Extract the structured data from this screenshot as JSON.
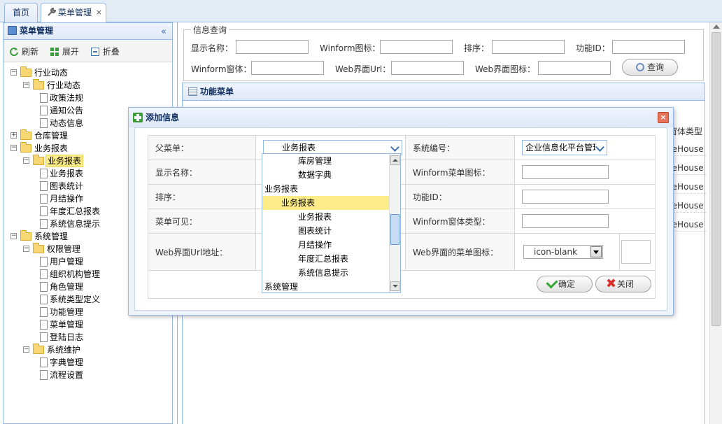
{
  "tabs": [
    {
      "label": "首页"
    },
    {
      "label": "菜单管理",
      "close": "×"
    }
  ],
  "left_panel": {
    "title": "菜单管理",
    "collapse": "«",
    "tools": {
      "refresh": "刷新",
      "expand": "展开",
      "collapse": "折叠"
    },
    "tree": [
      {
        "label": "行业动态",
        "level": 0,
        "type": "folder",
        "toggle": "−"
      },
      {
        "label": "行业动态",
        "level": 1,
        "type": "folder",
        "toggle": "−"
      },
      {
        "label": "政策法规",
        "level": 2,
        "type": "file"
      },
      {
        "label": "通知公告",
        "level": 2,
        "type": "file"
      },
      {
        "label": "动态信息",
        "level": 2,
        "type": "file"
      },
      {
        "label": "仓库管理",
        "level": 0,
        "type": "folder",
        "toggle": "+"
      },
      {
        "label": "业务报表",
        "level": 0,
        "type": "folder",
        "toggle": "−"
      },
      {
        "label": "业务报表",
        "level": 1,
        "type": "folder",
        "toggle": "−",
        "selected": true
      },
      {
        "label": "业务报表",
        "level": 2,
        "type": "file"
      },
      {
        "label": "图表统计",
        "level": 2,
        "type": "file"
      },
      {
        "label": "月结操作",
        "level": 2,
        "type": "file"
      },
      {
        "label": "年度汇总报表",
        "level": 2,
        "type": "file"
      },
      {
        "label": "系统信息提示",
        "level": 2,
        "type": "file"
      },
      {
        "label": "系统管理",
        "level": 0,
        "type": "folder",
        "toggle": "−"
      },
      {
        "label": "权限管理",
        "level": 1,
        "type": "folder",
        "toggle": "−"
      },
      {
        "label": "用户管理",
        "level": 2,
        "type": "file"
      },
      {
        "label": "组织机构管理",
        "level": 2,
        "type": "file"
      },
      {
        "label": "角色管理",
        "level": 2,
        "type": "file"
      },
      {
        "label": "系统类型定义",
        "level": 2,
        "type": "file"
      },
      {
        "label": "功能管理",
        "level": 2,
        "type": "file"
      },
      {
        "label": "菜单管理",
        "level": 2,
        "type": "file"
      },
      {
        "label": "登陆日志",
        "level": 2,
        "type": "file"
      },
      {
        "label": "系统维护",
        "level": 1,
        "type": "folder",
        "toggle": "−"
      },
      {
        "label": "字典管理",
        "level": 2,
        "type": "file"
      },
      {
        "label": "流程设置",
        "level": 2,
        "type": "file"
      }
    ]
  },
  "query": {
    "legend": "信息查询",
    "fields": {
      "display_name": "显示名称：",
      "winform_icon": "Winform图标：",
      "sort": "排序：",
      "function_id": "功能ID：",
      "winform_form": "Winform窗体：",
      "web_url": "Web界面Url：",
      "web_icon": "Web界面图标："
    },
    "button": "查询"
  },
  "grid": {
    "title": "功能菜单",
    "column_partial": "窗体类型",
    "rows": [
      "reHouse",
      "reHouse",
      "reHouse",
      "reHouse",
      "reHouse"
    ]
  },
  "dialog": {
    "title": "添加信息",
    "close": "×",
    "labels": {
      "parent_menu": "父菜单：",
      "display_name": "显示名称：",
      "sort": "排序：",
      "visible": "菜单可见：",
      "web_url": "Web界面Url地址：",
      "system_no": "系统编号：",
      "winform_icon": "Winform菜单图标：",
      "function_id": "功能ID：",
      "winform_type": "Winform窗体类型：",
      "web_icon": "Web界面的菜单图标："
    },
    "parent_value": "业务报表",
    "system_value": "企业信息化平台管理",
    "web_icon_value": "icon-blank",
    "ok": "确定",
    "cancel": "关闭"
  },
  "dropdown_items": [
    {
      "label": "库房管理",
      "level": 2
    },
    {
      "label": "数据字典",
      "level": 2
    },
    {
      "label": "业务报表",
      "level": 0
    },
    {
      "label": "业务报表",
      "level": 1,
      "selected": true
    },
    {
      "label": "业务报表",
      "level": 2
    },
    {
      "label": "图表统计",
      "level": 2
    },
    {
      "label": "月结操作",
      "level": 2
    },
    {
      "label": "年度汇总报表",
      "level": 2
    },
    {
      "label": "系统信息提示",
      "level": 2
    },
    {
      "label": "系统管理",
      "level": 0
    }
  ]
}
